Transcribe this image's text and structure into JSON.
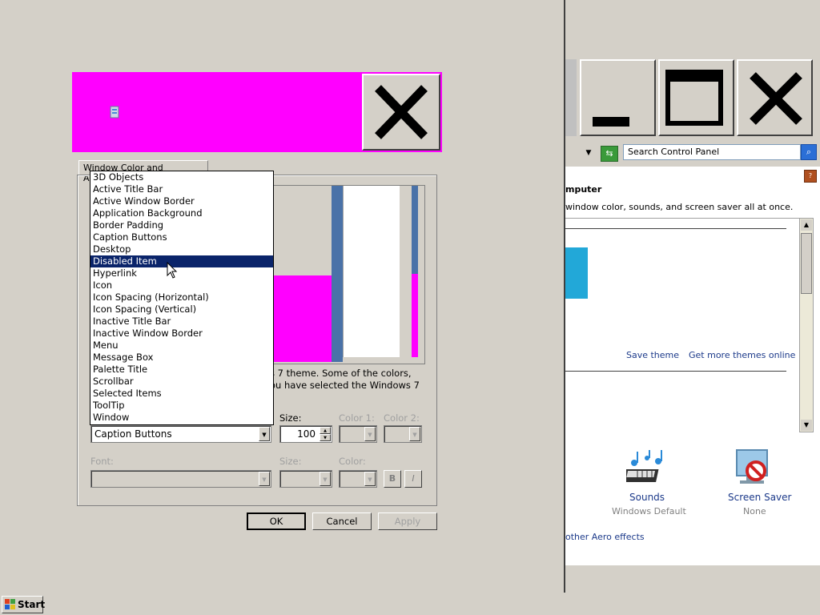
{
  "control_panel": {
    "search_placeholder": "Search Control Panel",
    "heading": "mputer",
    "description": "window color, sounds, and screen saver all at once.",
    "save_theme": "Save theme",
    "get_more_themes": "Get more themes online",
    "sounds_label": "Sounds",
    "sounds_value": "Windows Default",
    "screen_saver_label": "Screen Saver",
    "screen_saver_value": "None",
    "aero_link": "other Aero effects"
  },
  "dialog": {
    "tab_label": "Window Color and Appearance",
    "description_line1": "s 7 theme.  Some of the colors,",
    "description_line2": "ou have selected the Windows 7",
    "size_label": "Size:",
    "color1_label": "Color 1:",
    "color2_label": "Color 2:",
    "item_value": "Caption Buttons",
    "size_value": "100",
    "font_label": "Font:",
    "font_size_label": "Size:",
    "font_color_label": "Color:",
    "bold_label": "B",
    "italic_label": "I",
    "ok": "OK",
    "cancel": "Cancel",
    "apply": "Apply"
  },
  "item_list": [
    "3D Objects",
    "Active Title Bar",
    "Active Window Border",
    "Application Background",
    "Border Padding",
    "Caption Buttons",
    "Desktop",
    "Disabled Item",
    "Hyperlink",
    "Icon",
    "Icon Spacing (Horizontal)",
    "Icon Spacing (Vertical)",
    "Inactive Title Bar",
    "Inactive Window Border",
    "Menu",
    "Message Box",
    "Palette Title",
    "Scrollbar",
    "Selected Items",
    "ToolTip",
    "Window"
  ],
  "selected_item": "Disabled Item",
  "taskbar": {
    "start_label": "Start"
  },
  "colors": {
    "preview_title": "#ff00ff",
    "selection": "#0a246a",
    "link": "#1c3a8a"
  },
  "icons": [
    "minimize-icon",
    "maximize-icon",
    "close-icon",
    "refresh-icon",
    "search-icon",
    "help-icon",
    "sounds-icon",
    "screen-saver-icon",
    "windows-logo-icon",
    "cursor-icon"
  ]
}
